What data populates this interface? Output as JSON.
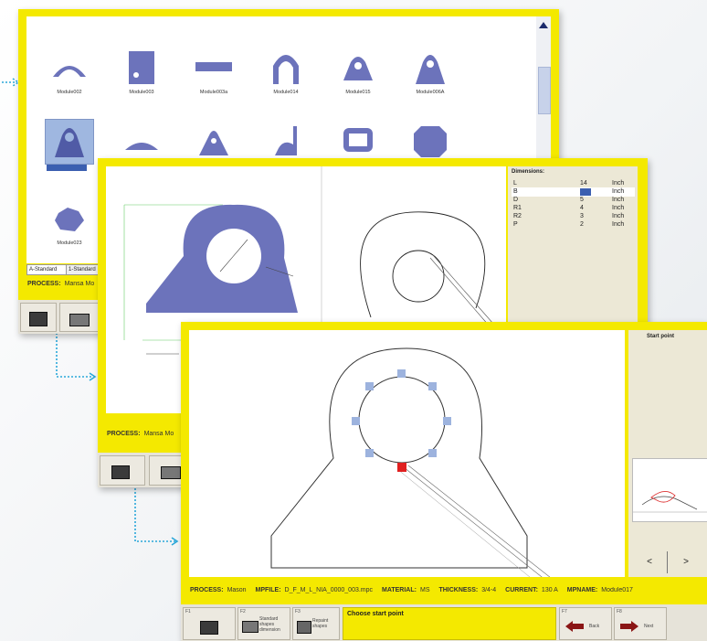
{
  "window1": {
    "shapes_row1": [
      "Module002",
      "Module003",
      "Module003a",
      "Module014",
      "Module015",
      "Module006A"
    ],
    "shapes_row3": [
      "Module023"
    ],
    "tabs": [
      "A-Standard",
      "1-Standard"
    ],
    "process_label": "PROCESS:",
    "process_text": "Mansa Mo",
    "colors": {
      "shape": "#6c73bb",
      "selected": "#9fb7e0"
    }
  },
  "window2": {
    "dimensions_title": "Dimensions:",
    "dimensions": [
      {
        "name": "L",
        "value": "14",
        "unit": "Inch"
      },
      {
        "name": "B",
        "value": "",
        "unit": "Inch"
      },
      {
        "name": "D",
        "value": "5",
        "unit": "Inch"
      },
      {
        "name": "R1",
        "value": "4",
        "unit": "Inch"
      },
      {
        "name": "R2",
        "value": "3",
        "unit": "Inch"
      },
      {
        "name": "P",
        "value": "2",
        "unit": "Inch"
      }
    ],
    "process_label": "PROCESS:",
    "process_text": "Mansa Mo"
  },
  "window3": {
    "side_title": "Start point",
    "nav_prev": "<",
    "nav_next": ">",
    "status": {
      "process_label": "PROCESS:",
      "process_value": "Mason",
      "mpfile_label": "MPFILE:",
      "mpfile_value": "D_F_M_L_NIA_0000_003.mpc",
      "material_label": "MATERIAL:",
      "material_value": "MS",
      "thickness_label": "THICKNESS:",
      "thickness_value": "3/4-4",
      "current_label": "CURRENT:",
      "current_value": "130 A",
      "mpname_label": "MPNAME:",
      "mpname_value": "Module017"
    },
    "toolbar": {
      "btn1_fkey": "F1",
      "btn2_fkey": "F2",
      "btn2_label": "Standard shapes dimension",
      "btn3_fkey": "F3",
      "btn3_label": "Repaint shapes",
      "message": "Choose start point",
      "back_fkey": "F7",
      "back_label": "Back",
      "next_fkey": "F8",
      "next_label": "Next"
    }
  },
  "colors": {
    "yellow": "#f4e900",
    "connector": "#2aa7d9",
    "part_fill": "#6c73bb",
    "handle": "#9db3de",
    "start_handle": "#e02020"
  }
}
